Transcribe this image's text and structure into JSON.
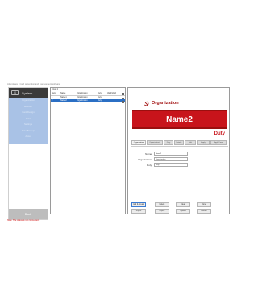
{
  "window": {
    "title": "Attendance • Card generation and management software"
  },
  "sidebar": {
    "title": "System",
    "logo_text": "ID",
    "menu": [
      "Organization",
      "Member",
      "Card Design",
      "Print",
      "Settings",
      "Data Backup",
      "About"
    ],
    "back_label": "Back"
  },
  "table": {
    "count_label": "Total: 2",
    "headers": [
      "Num",
      "Name",
      "Organization",
      "Duty",
      "Valid/Valid"
    ],
    "rows": [
      [
        "1",
        "Name1",
        "Organization",
        "Duty",
        ""
      ],
      [
        "2",
        "Name2",
        "Organization",
        "Duty",
        ""
      ]
    ],
    "selected_row": 1
  },
  "card": {
    "org_title": "Organization",
    "name": "Name2",
    "duty": "Duty",
    "emblem": "hammer-sickle-icon",
    "colors": {
      "band": "#c8141b",
      "band_edge": "#9b0f0f",
      "title": "#a31515"
    }
  },
  "tabs": [
    "Organization",
    "Organization2",
    "Duty",
    "Details",
    "Edit",
    "Apply",
    "Apply Form"
  ],
  "active_tab": 0,
  "fields": {
    "name_label": "Name:",
    "name_value": "Name2",
    "org_label": "Organization:",
    "org_value": "Organization",
    "duty_label": "Duty:",
    "duty_value": "Duty"
  },
  "actions": [
    "Add & Create",
    "Delete",
    "Clear",
    "Done",
    "Import",
    "Export",
    "Upload",
    "Return"
  ],
  "status_text": "Note: The status is not connected.",
  "accent_color": "#2b6fc4"
}
